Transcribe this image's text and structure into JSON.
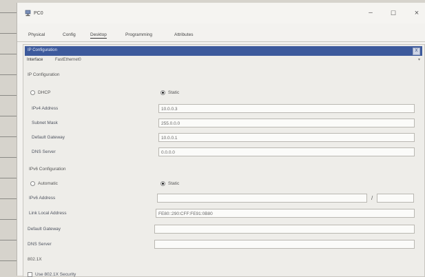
{
  "window": {
    "title": "PC0",
    "minimize_glyph": "–",
    "maximize_glyph": "☐",
    "close_glyph": "×",
    "icon": "pc-icon"
  },
  "tabs": [
    {
      "label": "Physical",
      "active": false
    },
    {
      "label": "Config",
      "active": false
    },
    {
      "label": "Desktop",
      "active": true
    },
    {
      "label": "Programming",
      "active": false
    },
    {
      "label": "Attributes",
      "active": false
    }
  ],
  "ip_config": {
    "header_title": "IP Configuration",
    "header_close": "X",
    "interface_label": "Interface",
    "interface_value": "FastEthernet0",
    "ipv4": {
      "section_title": "IP Configuration",
      "dhcp_label": "DHCP",
      "static_label": "Static",
      "mode": "Static",
      "ipv4_address_label": "IPv4 Address",
      "ipv4_address": "10.0.0.3",
      "subnet_mask_label": "Subnet Mask",
      "subnet_mask": "255.0.0.0",
      "default_gateway_label": "Default Gateway",
      "default_gateway": "10.0.0.1",
      "dns_server_label": "DNS Server",
      "dns_server": "0.0.0.0"
    },
    "ipv6": {
      "section_title": "IPv6 Configuration",
      "automatic_label": "Automatic",
      "static_label": "Static",
      "mode": "Static",
      "ipv6_address_label": "IPv6 Address",
      "ipv6_address": "",
      "prefix_separator": "/",
      "prefix_length": "",
      "link_local_label": "Link Local Address",
      "link_local_address": "FE80::290:CFF:FE91:0B80",
      "default_gateway_label": "Default Gateway",
      "default_gateway": "",
      "dns_server_label": "DNS Server",
      "dns_server": ""
    },
    "dot1x": {
      "section_title": "802.1X",
      "use_label": "Use 802.1X Security"
    }
  }
}
